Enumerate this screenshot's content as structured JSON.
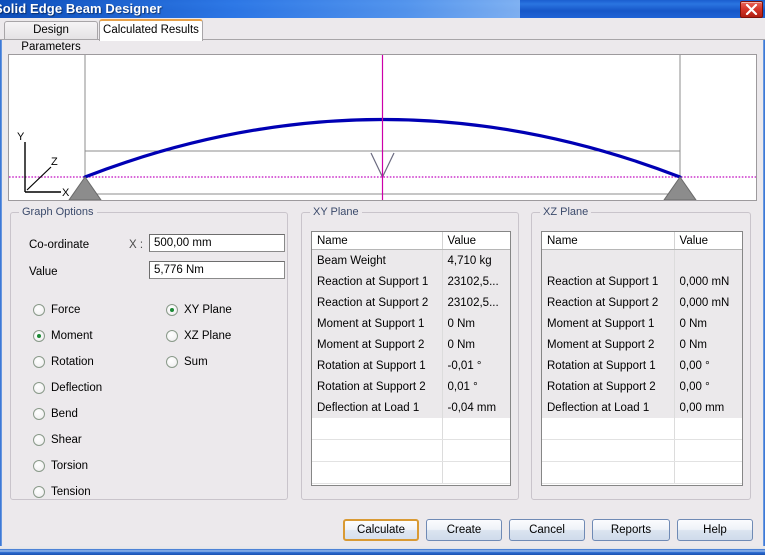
{
  "window": {
    "title": "Solid Edge Beam Designer",
    "close_icon": "close-icon"
  },
  "tabs": [
    {
      "label": "Design Parameters",
      "active": false
    },
    {
      "label": "Calculated Results",
      "active": true
    }
  ],
  "graph": {
    "axis_triad": {
      "y": "Y",
      "z": "Z",
      "x": "X"
    },
    "curve_color": "#0000b4",
    "baseline_color": "#cc33cc",
    "cursor_color": "#cc00aa",
    "support_color": "#8c8c8c"
  },
  "graph_options": {
    "legend": "Graph Options",
    "coordinate_label": "Co-ordinate",
    "coordinate_axis_label": "X :",
    "coordinate_value": "500,00 mm",
    "value_label": "Value",
    "value_value": "5,776 Nm",
    "quantity_options": [
      {
        "label": "Force",
        "checked": false
      },
      {
        "label": "Moment",
        "checked": true
      },
      {
        "label": "Rotation",
        "checked": false
      },
      {
        "label": "Deflection",
        "checked": false
      },
      {
        "label": "Bend",
        "checked": false
      },
      {
        "label": "Shear",
        "checked": false
      },
      {
        "label": "Torsion",
        "checked": false
      },
      {
        "label": "Tension",
        "checked": false
      }
    ],
    "plane_options": [
      {
        "label": "XY Plane",
        "checked": true
      },
      {
        "label": "XZ Plane",
        "checked": false
      },
      {
        "label": "Sum",
        "checked": false
      }
    ]
  },
  "xy_plane": {
    "legend": "XY Plane",
    "columns": [
      "Name",
      "Value"
    ],
    "rows": [
      [
        "Beam Weight",
        "4,710 kg"
      ],
      [
        "Reaction at Support 1",
        "23102,5..."
      ],
      [
        "Reaction at Support 2",
        "23102,5..."
      ],
      [
        "Moment at Support 1",
        "0 Nm"
      ],
      [
        "Moment at Support 2",
        "0 Nm"
      ],
      [
        "Rotation at Support 1",
        "-0,01 °"
      ],
      [
        "Rotation at Support 2",
        "0,01 °"
      ],
      [
        "Deflection at Load 1",
        "-0,04 mm"
      ]
    ],
    "empty_rows": 3
  },
  "xz_plane": {
    "legend": "XZ Plane",
    "columns": [
      "Name",
      "Value"
    ],
    "rows": [
      [
        "",
        ""
      ],
      [
        "Reaction at Support 1",
        "0,000 mN"
      ],
      [
        "Reaction at Support 2",
        "0,000 mN"
      ],
      [
        "Moment at Support 1",
        "0 Nm"
      ],
      [
        "Moment at Support 2",
        "0 Nm"
      ],
      [
        "Rotation at Support 1",
        "0,00 °"
      ],
      [
        "Rotation at Support 2",
        "0,00 °"
      ],
      [
        "Deflection at Load 1",
        "0,00 mm"
      ]
    ],
    "empty_rows": 3
  },
  "buttons": [
    {
      "label": "Calculate",
      "default": true
    },
    {
      "label": "Create",
      "default": false
    },
    {
      "label": "Cancel",
      "default": false
    },
    {
      "label": "Reports",
      "default": false
    },
    {
      "label": "Help",
      "default": false
    }
  ]
}
